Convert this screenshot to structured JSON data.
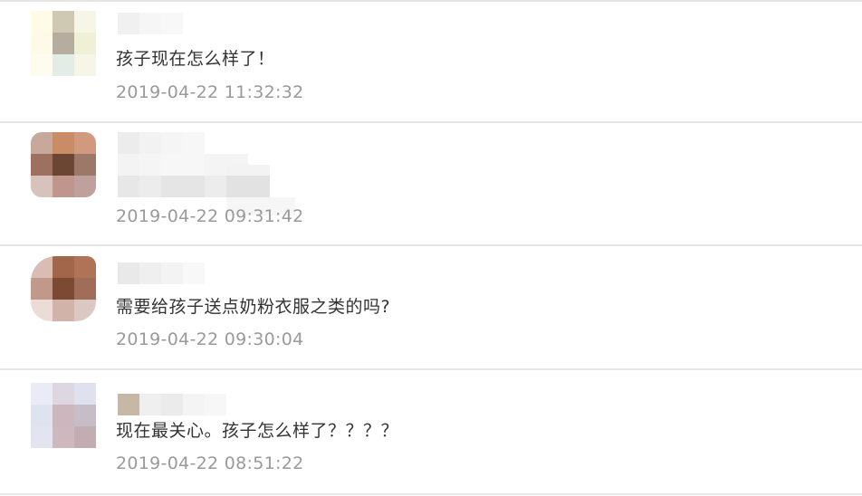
{
  "comments": [
    {
      "text": "孩子现在怎么样了！",
      "timestamp": "2019-04-22 11:32:32",
      "avatar_pixels": [
        "#fffbe6",
        "#cfc8b3",
        "#f7f6e6",
        "#fdfbe7",
        "#b6ada0",
        "#eef1d6",
        "#fdfcef",
        "#e4ece6",
        "#f5f6e8"
      ]
    },
    {
      "text": "",
      "timestamp": "2019-04-22 09:31:42",
      "avatar_pixels": [
        "#c8a89a",
        "#c98c66",
        "#d19a7e",
        "#9e7060",
        "#6a4633",
        "#9b7867",
        "#d7c2bc",
        "#c0958b",
        "#c0a09c"
      ]
    },
    {
      "text": "需要给孩子送点奶粉衣服之类的吗?",
      "timestamp": "2019-04-22 09:30:04",
      "avatar_pixels": [
        "#d9bdb5",
        "#a0674a",
        "#b07357",
        "#c1998b",
        "#7c4a32",
        "#a06d58",
        "#ebdcd8",
        "#d1b3aa",
        "#dcc8c2"
      ]
    },
    {
      "text": "现在最关心。孩子怎么样了？？？？",
      "timestamp": "2019-04-22 08:51:22",
      "avatar_pixels": [
        "#e9ecf6",
        "#dcd7e0",
        "#dfe2ee",
        "#dfe3ef",
        "#cbb7bd",
        "#c7bdc7",
        "#e2e4f0",
        "#cdb8be",
        "#c2adb3"
      ]
    }
  ],
  "colors": {
    "text": "#333333",
    "timestamp": "#9a9a9a",
    "divider": "#e6e6e6",
    "background": "#ffffff"
  }
}
